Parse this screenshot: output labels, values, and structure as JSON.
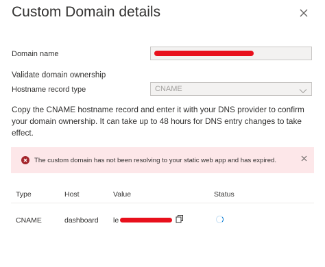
{
  "dialog": {
    "title": "Custom Domain details",
    "close_icon": "close-icon"
  },
  "form": {
    "domain_name_label": "Domain name",
    "domain_name_value": "",
    "validate_heading": "Validate domain ownership",
    "hostname_record_type_label": "Hostname record type",
    "hostname_record_type_value": "CNAME"
  },
  "description": "Copy the CNAME hostname record and enter it with your DNS provider to confirm your domain ownership. It can take up to 48 hours for DNS entry changes to take effect.",
  "error_banner": {
    "icon": "error-circle-icon",
    "message": "The custom domain has not been resolving to your static web app and has expired.",
    "color": "#a4262c",
    "background": "#fde7e9"
  },
  "table": {
    "headers": [
      "Type",
      "Host",
      "Value",
      "Status"
    ],
    "rows": [
      {
        "type": "CNAME",
        "host": "dashboard",
        "value_visible": "le",
        "copy_icon": "copy-icon",
        "status_icon": "loading-spinner-icon"
      }
    ]
  },
  "colors": {
    "redaction": "#e8101c",
    "accent": "#0078d4"
  }
}
